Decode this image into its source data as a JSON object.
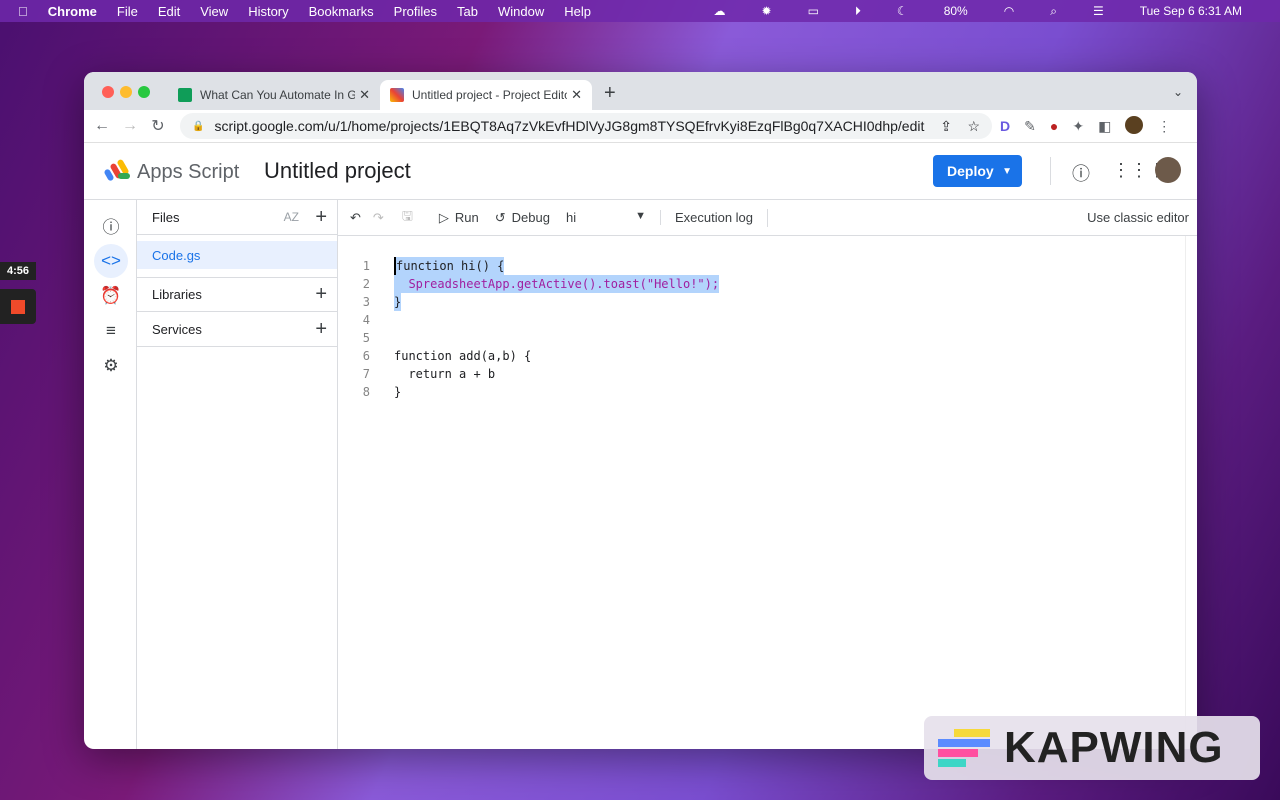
{
  "menubar": {
    "app": "Chrome",
    "items": [
      "File",
      "Edit",
      "View",
      "History",
      "Bookmarks",
      "Profiles",
      "Tab",
      "Window",
      "Help"
    ],
    "battery": "80%",
    "datetime": "Tue Sep 6  6:31 AM"
  },
  "tabs": [
    {
      "title": "What Can You Automate In Goo",
      "active": false
    },
    {
      "title": "Untitled project - Project Editor",
      "active": true
    }
  ],
  "url": "script.google.com/u/1/home/projects/1EBQT8Aq7zVkEvfHDlVyJG8gm8TYSQEfrvKyi8EzqFlBg0q7XACHI0dhp/edit",
  "app": {
    "name": "Apps Script",
    "project": "Untitled project",
    "deploy": "Deploy"
  },
  "files": {
    "header": "Files",
    "sort": "AZ",
    "file": "Code.gs",
    "libraries": "Libraries",
    "services": "Services"
  },
  "toolbar": {
    "run": "Run",
    "debug": "Debug",
    "function": "hi",
    "log": "Execution log",
    "classic": "Use classic editor"
  },
  "code": [
    "function hi() {",
    "  SpreadsheetApp.getActive().toast(\"Hello!\");",
    "}",
    "",
    "",
    "function add(a,b) {",
    "  return a + b",
    "}"
  ],
  "overlay": {
    "timer": "4:56",
    "watermark": "KAPWING"
  }
}
